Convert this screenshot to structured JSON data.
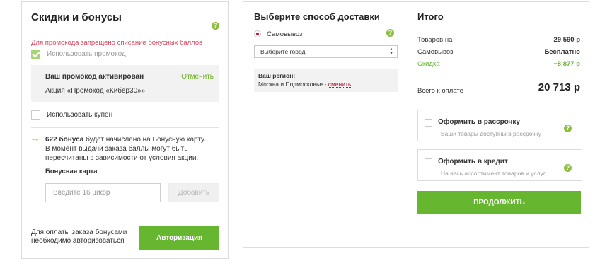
{
  "discounts": {
    "title": "Скидки и бонусы",
    "warning": "Для промокода запрещено списание бонусных баллов",
    "use_promo_label": "Использовать промокод",
    "promo_status": "Ваш промокод активирован",
    "promo_cancel": "Отменить",
    "promo_name": "Акция «Промокод «Кибер30»»",
    "use_coupon_label": "Использовать купон",
    "bonus_amount": "622 бонуса",
    "bonus_text_1": " будет начислено на Бонусную карту.",
    "bonus_text_2": "В момент выдачи заказа баллы могут быть пересчитаны в зависимости от условия акции.",
    "card_label": "Бонусная карта",
    "card_placeholder": "Введите 16 цифр",
    "add_button": "Добавить",
    "auth_note_line1": "Для оплаты заказа бонусами",
    "auth_note_line2": "необходимо авторизоваться",
    "auth_button": "Авторизация"
  },
  "delivery": {
    "title": "Выберите способ доставки",
    "pickup_label": "Самовывоз",
    "city_select": "Выберите город",
    "region_label": "Ваш регион:",
    "region_value": "Москва и Подмосковье",
    "region_sep": " - ",
    "region_change": "сменить"
  },
  "summary": {
    "title": "Итого",
    "goods_label": "Товаров на",
    "goods_value": "29 590 р",
    "pickup_label": "Самовывоз",
    "pickup_value": "Бесплатно",
    "discount_label": "Скидка",
    "discount_value": "−8 877 р",
    "total_label": "Всего к оплате",
    "total_value": "20 713 р",
    "installment_title": "Оформить в рассрочку",
    "installment_sub": "Ваши товары доступны в рассрочку",
    "credit_title": "Оформить в кредит",
    "credit_sub": "На весь ассортимент товаров и услуг",
    "continue_button": "ПРОДОЛЖИТЬ"
  },
  "help_glyph": "?",
  "colors": {
    "accent_green": "#66b72f",
    "warning_red": "#d9455e",
    "radio_red": "#c8102e"
  }
}
